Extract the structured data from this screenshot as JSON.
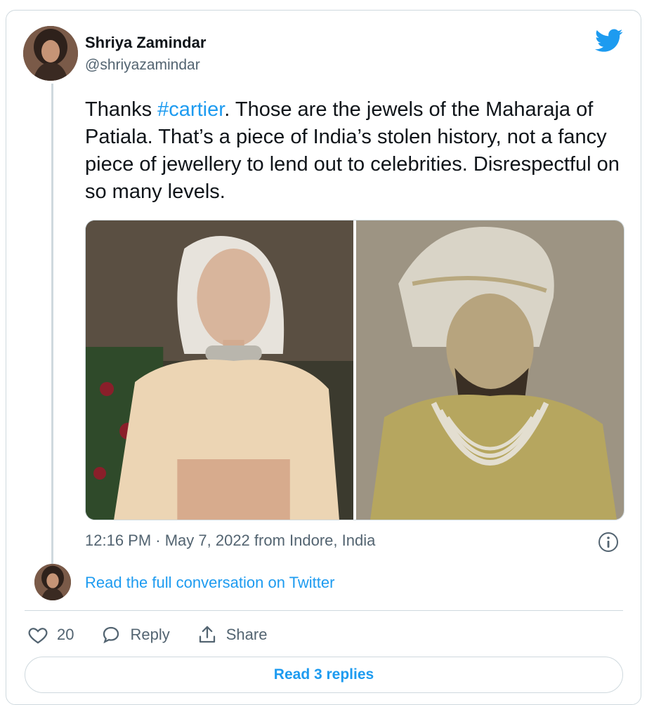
{
  "tweet": {
    "author_name": "Shriya Zamindar",
    "author_handle": "@shriyazamindar",
    "text_prefix": "Thanks ",
    "hashtag": "#cartier",
    "text_rest": ". Those are the jewels of the Maharaja of Patiala. That’s a piece of India’s stolen history, not a fancy piece of jewellery to lend out to celebrities. Disrespectful on so many levels.",
    "timestamp": "12:16 PM · May 7, 2022 from Indore, India"
  },
  "media": [
    {
      "icon": "photo-woman-met-gala"
    },
    {
      "icon": "photo-maharaja-portrait"
    }
  ],
  "conversation_link": "Read the full conversation on Twitter",
  "actions": {
    "like_count": "20",
    "reply_label": "Reply",
    "share_label": "Share"
  },
  "read_replies_label": "Read 3 replies",
  "colors": {
    "accent": "#1d9bf0",
    "text": "#0f1419",
    "muted": "#536471",
    "border": "#cfd9de"
  }
}
